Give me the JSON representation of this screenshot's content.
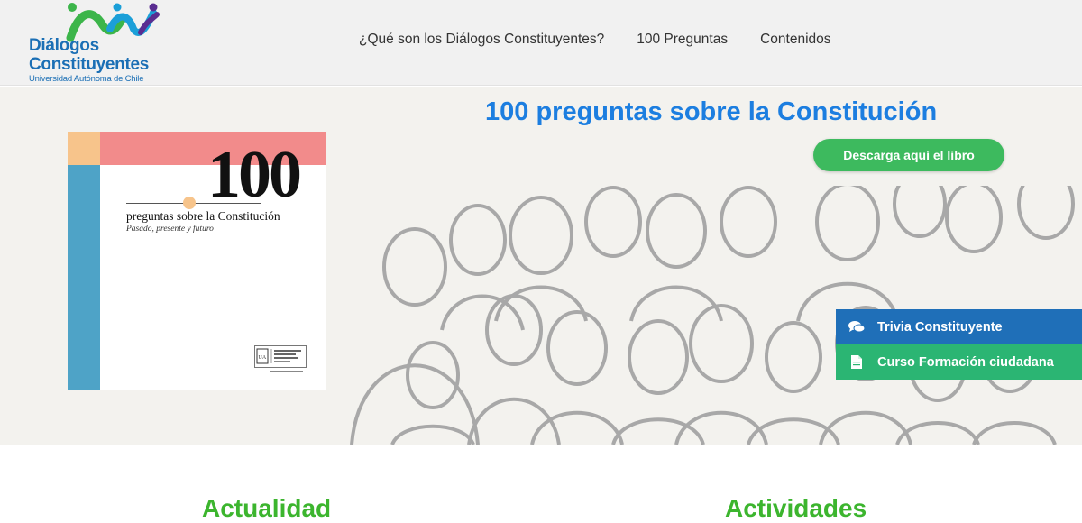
{
  "header": {
    "logo": {
      "title_line1": "Diálogos",
      "title_line2": "Constituyentes",
      "subtitle": "Universidad Autónoma de Chile"
    },
    "nav": [
      {
        "label": "¿Qué son los Diálogos Constituyentes?"
      },
      {
        "label": "100 Preguntas"
      },
      {
        "label": "Contenidos"
      }
    ]
  },
  "hero": {
    "title": "100 preguntas sobre la Constitución",
    "download_button": "Descarga aquí el libro",
    "book_cover": {
      "number": "100",
      "title": "preguntas sobre la Constitución",
      "subtitle": "Pasado, presente y futuro"
    }
  },
  "side_buttons": {
    "trivia": {
      "label": "Trivia Constituyente",
      "icon": "chat-icon"
    },
    "curso": {
      "label": "Curso Formación ciudadana",
      "icon": "document-icon"
    }
  },
  "sections": {
    "actualidad": "Actualidad",
    "actividades": "Actividades"
  },
  "colors": {
    "brand_blue": "#1c7ee0",
    "button_green": "#3dba5e",
    "section_green": "#3cb52e",
    "trivia_blue": "#1f6fb8",
    "curso_green": "#2bb573"
  }
}
